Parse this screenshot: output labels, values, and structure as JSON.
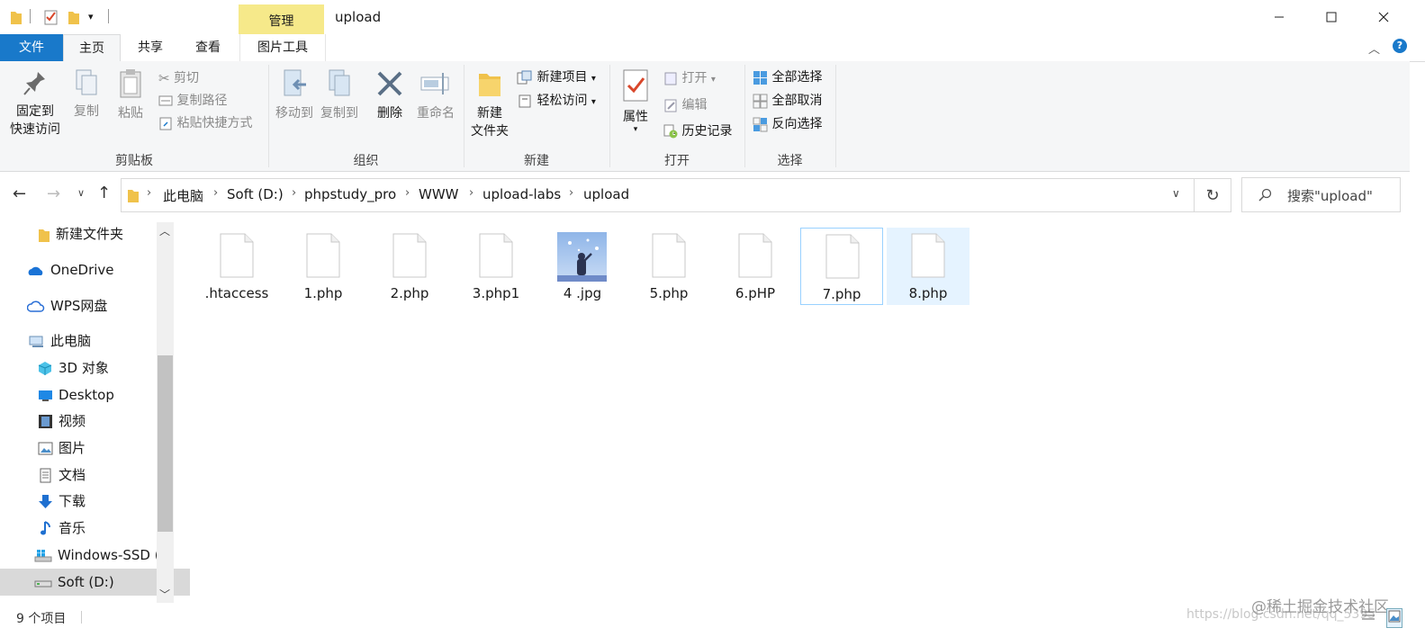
{
  "window": {
    "title": "upload",
    "context_tab": "管理",
    "controls": [
      "minimize",
      "maximize",
      "close"
    ]
  },
  "ribbon_tabs": [
    "文件",
    "主页",
    "共享",
    "查看",
    "图片工具"
  ],
  "ribbon": {
    "clipboard": {
      "pin_line1": "固定到",
      "pin_line2": "快速访问",
      "copy": "复制",
      "paste": "粘贴",
      "cut": "剪切",
      "copy_path": "复制路径",
      "paste_shortcut": "粘贴快捷方式",
      "label": "剪贴板"
    },
    "organize": {
      "move_to": "移动到",
      "copy_to": "复制到",
      "delete": "删除",
      "rename": "重命名",
      "label": "组织"
    },
    "new": {
      "new_folder_line1": "新建",
      "new_folder_line2": "文件夹",
      "new_item": "新建项目",
      "easy_access": "轻松访问",
      "label": "新建"
    },
    "open": {
      "properties": "属性",
      "open": "打开",
      "edit": "编辑",
      "history": "历史记录",
      "label": "打开"
    },
    "select": {
      "select_all": "全部选择",
      "select_none": "全部取消",
      "invert": "反向选择",
      "label": "选择"
    }
  },
  "address": {
    "breadcrumbs": [
      "此电脑",
      "Soft (D:)",
      "phpstudy_pro",
      "WWW",
      "upload-labs",
      "upload"
    ],
    "search_placeholder": "搜索\"upload\""
  },
  "nav_pane": [
    {
      "label": "新建文件夹",
      "icon": "folder-icon"
    },
    {
      "label": "OneDrive",
      "icon": "onedrive-icon"
    },
    {
      "label": "WPS网盘",
      "icon": "cloud-icon"
    },
    {
      "label": "此电脑",
      "icon": "pc-icon"
    },
    {
      "label": "3D 对象",
      "icon": "3d-objects-icon"
    },
    {
      "label": "Desktop",
      "icon": "desktop-icon"
    },
    {
      "label": "视频",
      "icon": "video-icon"
    },
    {
      "label": "图片",
      "icon": "pictures-icon"
    },
    {
      "label": "文档",
      "icon": "documents-icon"
    },
    {
      "label": "下载",
      "icon": "download-icon"
    },
    {
      "label": "音乐",
      "icon": "music-icon"
    },
    {
      "label": "Windows-SSD (",
      "icon": "drive-windows-icon"
    },
    {
      "label": "Soft (D:)",
      "icon": "drive-icon",
      "selected": true
    }
  ],
  "files": [
    {
      "name": ".htaccess",
      "type": "document"
    },
    {
      "name": "1.php",
      "type": "document"
    },
    {
      "name": "2.php",
      "type": "document"
    },
    {
      "name": "3.php1",
      "type": "document"
    },
    {
      "name": "4 .jpg",
      "type": "image"
    },
    {
      "name": "5.php",
      "type": "document"
    },
    {
      "name": "6.pHP",
      "type": "document"
    },
    {
      "name": "7.php",
      "type": "document",
      "state": "focused"
    },
    {
      "name": "8.php",
      "type": "document",
      "state": "hover"
    }
  ],
  "status": {
    "item_count": "9 个项目"
  },
  "watermark": {
    "text": "@稀土掘金技术社区",
    "url_text": "https://blog.csdn.net/qq_5395"
  },
  "colors": {
    "file_tab": "#1979ca",
    "manage_tab": "#f6e98a",
    "hover": "#e5f3ff",
    "focus_border": "#99d1ff"
  }
}
